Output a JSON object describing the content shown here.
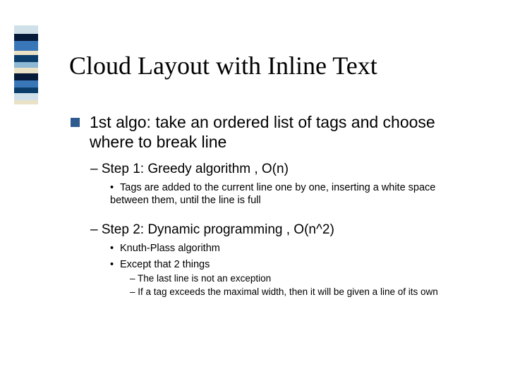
{
  "decor_colors": [
    {
      "c": "#cfe0e8",
      "h": 12
    },
    {
      "c": "#061a3a",
      "h": 10
    },
    {
      "c": "#3a77b8",
      "h": 14
    },
    {
      "c": "#e9e2c7",
      "h": 6
    },
    {
      "c": "#0b3d6b",
      "h": 10
    },
    {
      "c": "#8fb8d4",
      "h": 8
    },
    {
      "c": "#e9e2c7",
      "h": 8
    },
    {
      "c": "#061a3a",
      "h": 10
    },
    {
      "c": "#3a77b8",
      "h": 10
    },
    {
      "c": "#0b3d6b",
      "h": 8
    },
    {
      "c": "#cfe0e8",
      "h": 10
    },
    {
      "c": "#e9e2c7",
      "h": 6
    }
  ],
  "title": "Cloud Layout with Inline Text",
  "lvl1": "1st algo: take an ordered list of tags and choose where to break line",
  "step1": {
    "heading": "– Step 1: Greedy algorithm , O(n)",
    "items": [
      "Tags are added to the current line one by one, inserting a white space between them, until the line is full"
    ]
  },
  "step2": {
    "heading": "– Step 2: Dynamic programming , O(n^2)",
    "items": [
      "Knuth-Plass algorithm",
      "Except that 2 things"
    ],
    "subitems": [
      "The last line is not an exception",
      "If a tag exceeds the maximal width, then it will be given a line of its own"
    ]
  }
}
